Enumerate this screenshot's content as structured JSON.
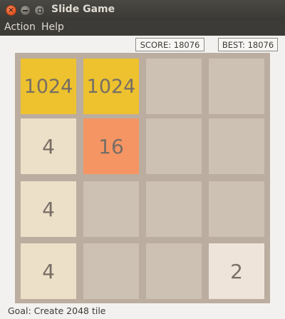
{
  "window": {
    "title": "Slide Game"
  },
  "menu": {
    "items": [
      "Action",
      "Help"
    ]
  },
  "scores": {
    "score_text": "SCORE: 18076",
    "best_text": "BEST: 18076"
  },
  "board": {
    "rows": [
      [
        "1024",
        "1024",
        "",
        ""
      ],
      [
        "4",
        "16",
        "",
        ""
      ],
      [
        "4",
        "",
        "",
        ""
      ],
      [
        "4",
        "",
        "",
        "2"
      ]
    ]
  },
  "status": {
    "text": "Goal: Create 2048 tile"
  },
  "colors": {
    "titlebar": "#3c3b37",
    "board_bg": "#bbad9f",
    "empty_tile": "#cdc1b3",
    "tile_2": "#eee4da",
    "tile_4": "#ede0c8",
    "tile_16": "#f59563",
    "tile_1024": "#edc22e",
    "close_button": "#e3531e"
  }
}
